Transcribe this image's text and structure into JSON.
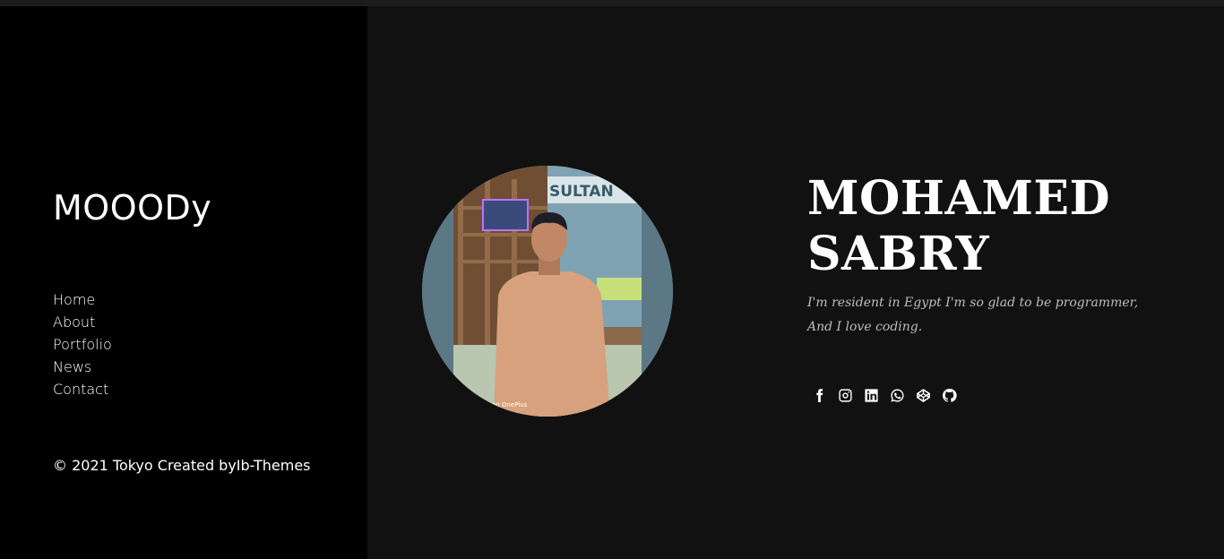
{
  "sidebar": {
    "logo": "MOOODy",
    "menu": [
      {
        "label": "Home"
      },
      {
        "label": "About"
      },
      {
        "label": "Portfolio"
      },
      {
        "label": "News"
      },
      {
        "label": "Contact"
      }
    ],
    "copyright": "© 2021 Tokyo Created byIb-Themes"
  },
  "hero": {
    "name_line1": "MOHAMED",
    "name_line2": "SABRY",
    "bio": "I'm resident in Egypt I'm so glad to be programmer, And I love coding.",
    "photo_sign": "SULTAN",
    "photo_watermark": "on OnePlus"
  },
  "social": [
    {
      "icon": "facebook-icon"
    },
    {
      "icon": "instagram-icon"
    },
    {
      "icon": "linkedin-icon"
    },
    {
      "icon": "whatsapp-icon"
    },
    {
      "icon": "codepen-icon"
    },
    {
      "icon": "github-icon"
    }
  ],
  "colors": {
    "sidebar_bg": "#000000",
    "main_bg": "#111111",
    "text": "#ffffff",
    "bio_text": "#bdbdbd"
  }
}
